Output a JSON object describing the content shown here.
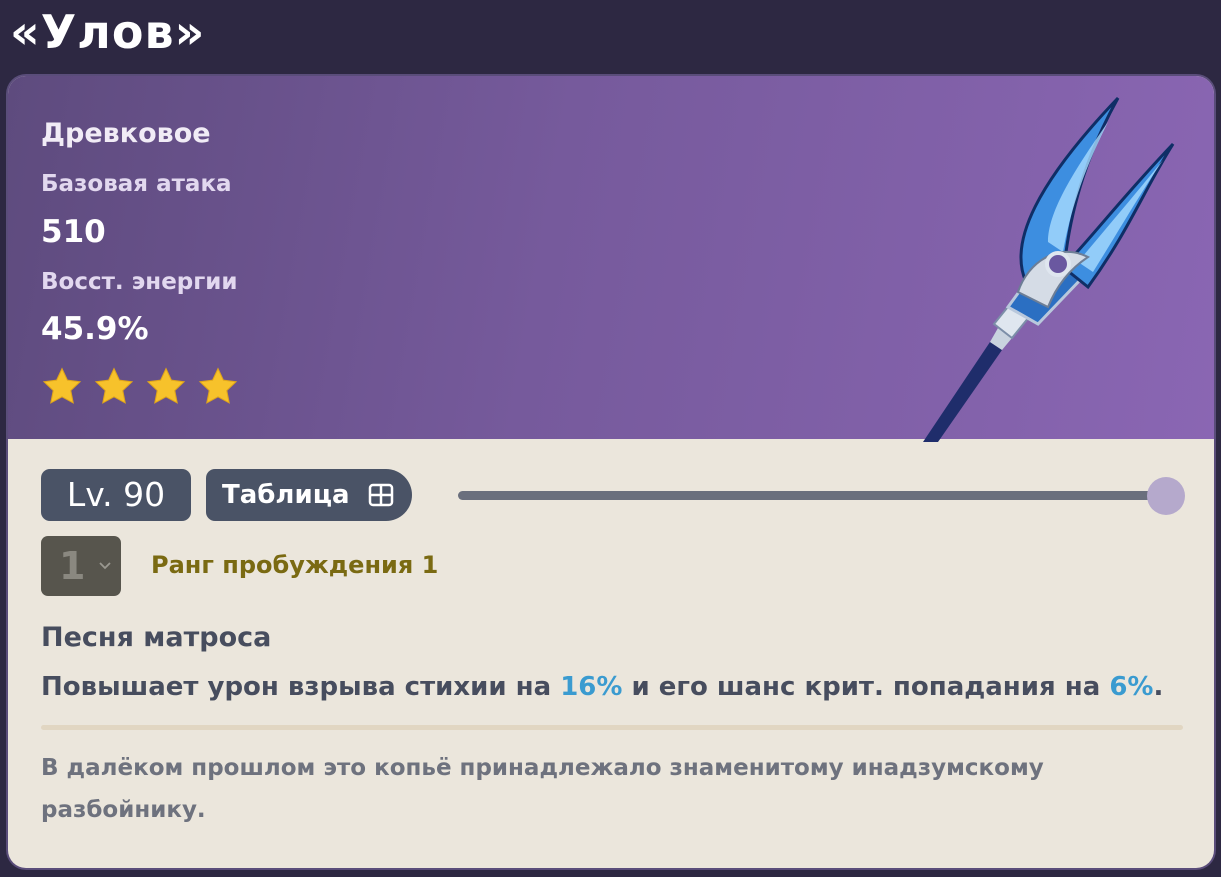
{
  "page": {
    "title": "«Улов»"
  },
  "weapon": {
    "type": "Древковое",
    "stats": [
      {
        "label": "Базовая атака",
        "value": "510"
      },
      {
        "label": "Восст. энергии",
        "value": "45.9%"
      }
    ],
    "rarity_stars": 4,
    "star_color": "#f7c22b",
    "art_icon": "polearm-weapon-art"
  },
  "controls": {
    "level_label": "Lv. 90",
    "table_button_label": "Таблица",
    "level_slider_value": 1.0,
    "refinement_value": "1",
    "refinement_label": "Ранг пробуждения 1"
  },
  "passive": {
    "name": "Песня матроса",
    "desc_part1": "Повышает урон взрыва стихии на ",
    "value1": "16%",
    "desc_part2": " и его шанс крит. попадания на ",
    "value2": "6%",
    "desc_part3": ".",
    "highlight_color": "#3a9bd0"
  },
  "lore": "В далёком прошлом это копьё принадлежало знаменитому инадзумскому разбойнику."
}
